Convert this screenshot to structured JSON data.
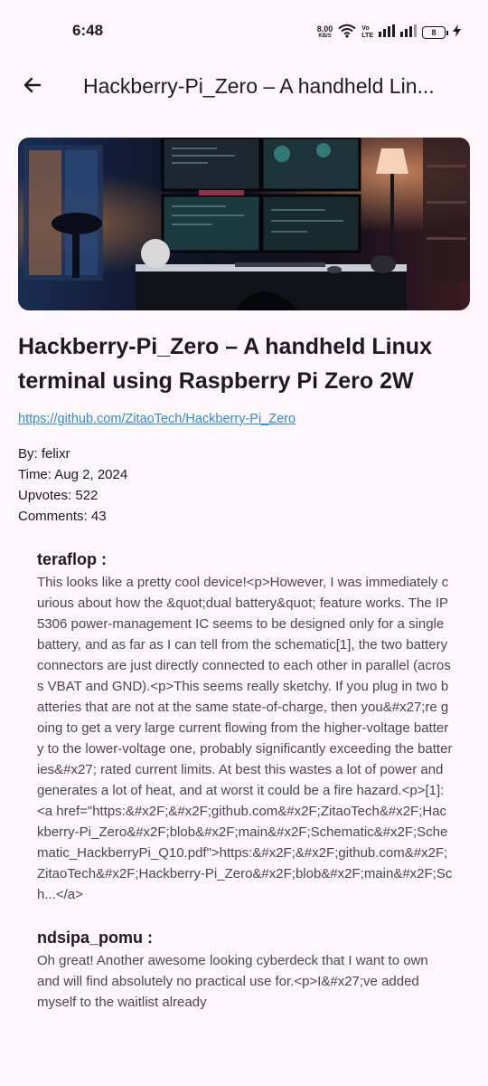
{
  "status_bar": {
    "time": "6:48",
    "net_speed_value": "8.00",
    "net_speed_unit": "KB/S",
    "volte_top": "Vo",
    "volte_bottom": "LTE",
    "battery": "8"
  },
  "app_bar": {
    "title": "Hackberry-Pi_Zero – A handheld Lin..."
  },
  "story": {
    "title": "Hackberry-Pi_Zero – A handheld Linux terminal using Raspberry Pi Zero 2W",
    "url": "https://github.com/ZitaoTech/Hackberry-Pi_Zero",
    "by": "By: felixr",
    "time": "Time: Aug 2, 2024",
    "upvotes": "Upvotes: 522",
    "comments": "Comments: 43"
  },
  "comments": [
    {
      "author": "teraflop :",
      "text": "This looks like a pretty cool device!<p>However, I was immediately curious about how the &quot;dual battery&quot; feature works. The IP5306 power-management IC seems to be designed only for a single battery, and as far as I can tell from the schematic[1], the two battery connectors are just directly connected to each other in parallel (across VBAT and GND).<p>This seems really sketchy. If you plug in two batteries that are not at the same state-of-charge, then you&#x27;re going to get a very large current flowing from the higher-voltage battery to the lower-voltage one, probably significantly exceeding the batteries&#x27; rated current limits. At best this wastes a lot of power and generates a lot of heat, and at worst it could be a fire hazard.<p>[1]: <a href=\"https:&#x2F;&#x2F;github.com&#x2F;ZitaoTech&#x2F;Hackberry-Pi_Zero&#x2F;blob&#x2F;main&#x2F;Schematic&#x2F;Schematic_HackberryPi_Q10.pdf\">https:&#x2F;&#x2F;github.com&#x2F;ZitaoTech&#x2F;Hackberry-Pi_Zero&#x2F;blob&#x2F;main&#x2F;Sch...</a>"
    },
    {
      "author": "ndsipa_pomu :",
      "text": "Oh great! Another awesome looking cyberdeck that I want to own and will find absolutely no practical use for.<p>I&#x27;ve added myself to the waitlist already"
    }
  ],
  "icons": {
    "back": "arrow-back-icon",
    "wifi": "wifi-icon",
    "signal": "signal-icon",
    "charging": "bolt-icon"
  }
}
